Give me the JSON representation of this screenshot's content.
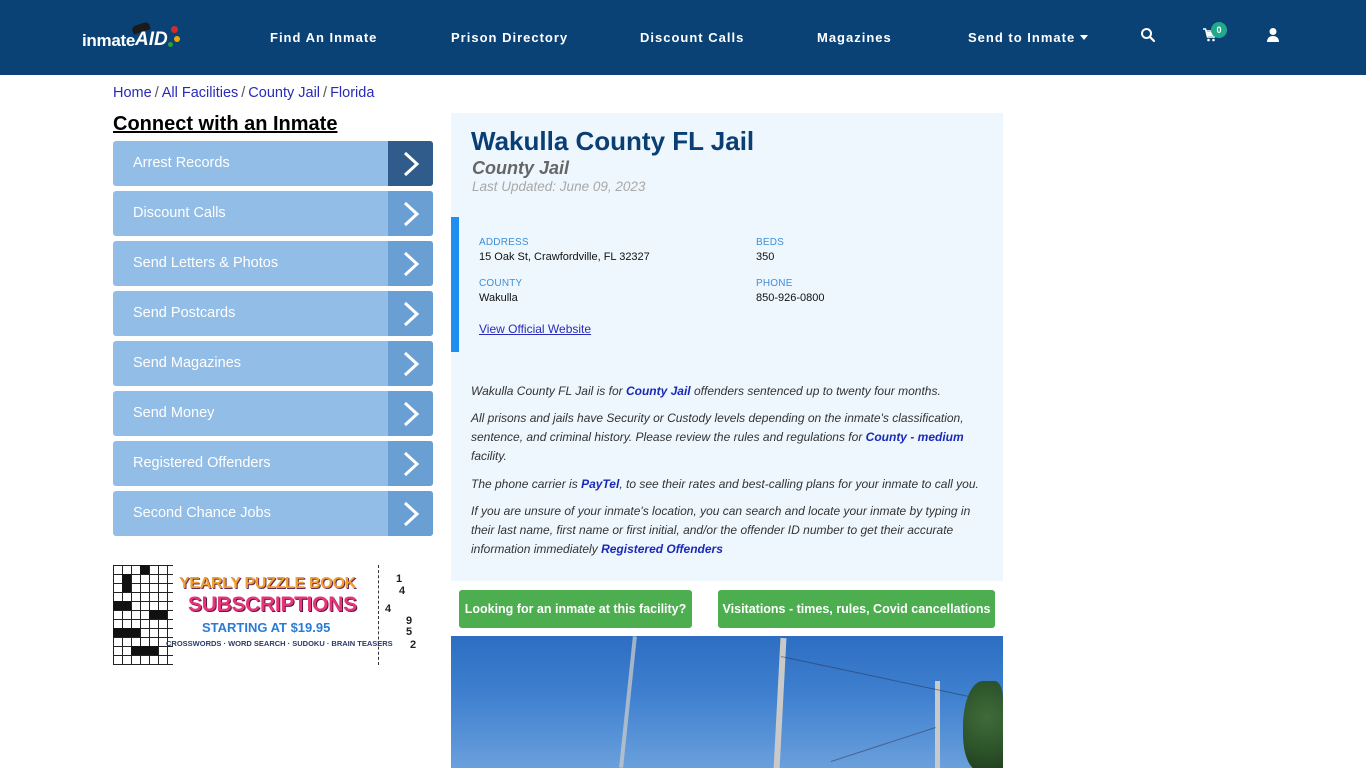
{
  "navbar": {
    "logo_text": "inmate",
    "logo_text_accent": "AID",
    "items": [
      {
        "label": "Find An Inmate"
      },
      {
        "label": "Prison Directory"
      },
      {
        "label": "Discount Calls"
      },
      {
        "label": "Magazines"
      },
      {
        "label": "Send to Inmate",
        "has_dropdown": true
      }
    ],
    "icons": {
      "search": "search-icon",
      "cart": "cart-icon",
      "user": "user-icon"
    },
    "cart_count": "0"
  },
  "breadcrumb": [
    {
      "label": "Home"
    },
    {
      "label": "All Facilities"
    },
    {
      "label": "County Jail"
    },
    {
      "label": "Florida"
    }
  ],
  "sidebar": {
    "title": "Connect with an Inmate",
    "items": [
      {
        "label": "Arrest Records",
        "active": true
      },
      {
        "label": "Discount Calls"
      },
      {
        "label": "Send Letters & Photos"
      },
      {
        "label": "Send Postcards"
      },
      {
        "label": "Send Magazines"
      },
      {
        "label": "Send Money"
      },
      {
        "label": "Registered Offenders"
      },
      {
        "label": "Second Chance Jobs"
      }
    ],
    "ad": {
      "line1": "YEARLY PUZZLE BOOK",
      "line2": "SUBSCRIPTIONS",
      "line3": "STARTING AT $19.95",
      "line4": "CROSSWORDS · WORD SEARCH · SUDOKU · BRAIN TEASERS",
      "sudoku_numbers": [
        "1",
        "4",
        "4",
        "9",
        "5",
        "2"
      ]
    }
  },
  "facility": {
    "title": "Wakulla County FL Jail",
    "type": "County Jail",
    "last_updated": "Last Updated: June 09, 2023",
    "address_label": "ADDRESS",
    "address": "15 Oak St, Crawfordville, FL 32327",
    "beds_label": "BEDS",
    "beds": "350",
    "county_label": "COUNTY",
    "county": "Wakulla",
    "phone_label": "PHONE",
    "phone": "850-926-0800",
    "website_link": "View Official Website"
  },
  "description": {
    "p1_a": "Wakulla County FL Jail is for ",
    "p1_link": "County Jail",
    "p1_b": " offenders sentenced up to twenty four months.",
    "p2_a": "All prisons and jails have Security or Custody levels depending on the inmate's classification, sentence, and criminal history. Please review the rules and regulations for ",
    "p2_link": "County - medium",
    "p2_b": " facility.",
    "p3_a": "The phone carrier is ",
    "p3_link": "PayTel",
    "p3_b": ", to see their rates and best-calling plans for your inmate to call you.",
    "p4_a": "If you are unsure of your inmate's location, you can search and locate your inmate by typing in their last name, first name or first initial, and/or the offender ID number to get their accurate information immediately ",
    "p4_link": "Registered Offenders"
  },
  "actions": {
    "find_inmate": "Looking for an inmate at this facility?",
    "visitations": "Visitations - times, rules, Covid cancellations"
  },
  "photo": {
    "alt": "facility-street-photo"
  }
}
